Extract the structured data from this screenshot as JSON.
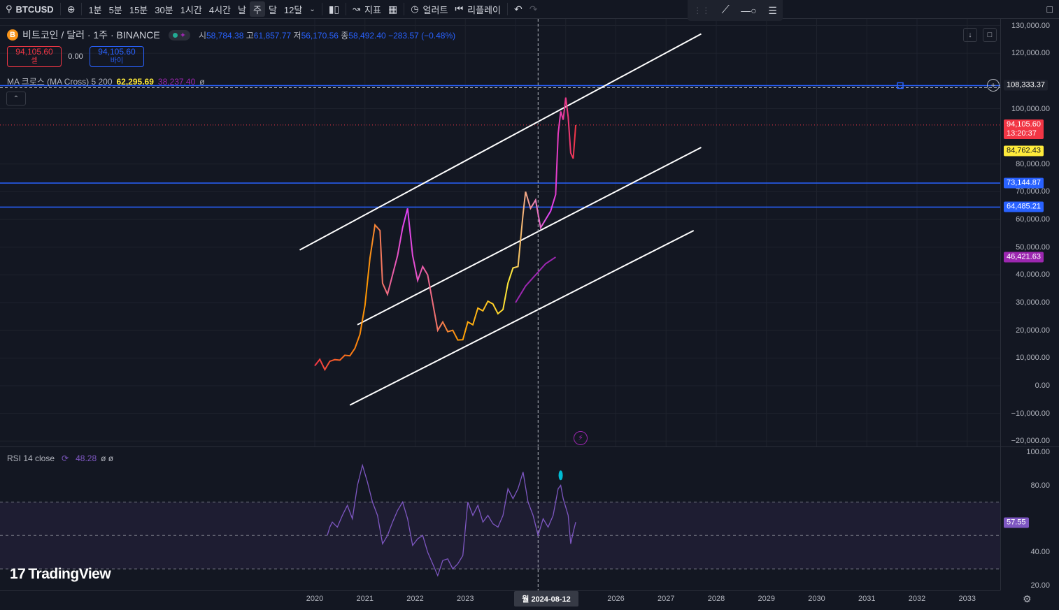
{
  "toolbar": {
    "symbol": "BTCUSD",
    "intervals": [
      "1분",
      "5분",
      "15분",
      "30분",
      "1시간",
      "4시간",
      "날",
      "주",
      "달",
      "12달"
    ],
    "active_interval": "주",
    "indicators_label": "지표",
    "alert_label": "얼러트",
    "replay_label": "리플레이"
  },
  "legend": {
    "title": "비트코인 / 달러 · 1주 · BINANCE",
    "o_label": "시",
    "o": "58,784.38",
    "h_label": "고",
    "h": "61,857.77",
    "l_label": "저",
    "l": "56,170.56",
    "c_label": "종",
    "c": "58,492.40",
    "change": "−283.57 (−0.48%)"
  },
  "sell": {
    "price": "94,105.60",
    "label": "셀"
  },
  "spread": "0.00",
  "buy": {
    "price": "94,105.60",
    "label": "바이"
  },
  "ma_indicator": {
    "name": "MA 크로스 (MA Cross) 5 200",
    "v1": "62,295.69",
    "v2": "38,237.40",
    "tail": "ø"
  },
  "rsi_indicator": {
    "name": "RSI 14 close",
    "value": "48.28",
    "tail": "ø ø"
  },
  "price_axis_labels": [
    {
      "label": "130,000.00",
      "v": 130000
    },
    {
      "label": "120,000.00",
      "v": 120000
    },
    {
      "label": "100,000.00",
      "v": 100000
    },
    {
      "label": "80,000.00",
      "v": 80000
    },
    {
      "label": "70,000.00",
      "v": 70000
    },
    {
      "label": "60,000.00",
      "v": 60000
    },
    {
      "label": "50,000.00",
      "v": 50000
    },
    {
      "label": "40,000.00",
      "v": 40000
    },
    {
      "label": "30,000.00",
      "v": 30000
    },
    {
      "label": "20,000.00",
      "v": 20000
    },
    {
      "label": "10,000.00",
      "v": 10000
    },
    {
      "label": "0.00",
      "v": 0
    },
    {
      "label": "−10,000.00",
      "v": -10000
    },
    {
      "label": "−20,000.00",
      "v": -20000
    }
  ],
  "rsi_axis_labels": [
    {
      "label": "100.00",
      "v": 100
    },
    {
      "label": "80.00",
      "v": 80
    },
    {
      "label": "40.00",
      "v": 40
    },
    {
      "label": "20.00",
      "v": 20
    }
  ],
  "price_tags": [
    {
      "label": "108,333.37",
      "v": 108333.37,
      "bg": "#1e222d",
      "color": "#ffffff"
    },
    {
      "label": "94,105.60",
      "sub": "13:20:37",
      "v": 94105.6,
      "bg": "#f23645",
      "color": "#ffffff"
    },
    {
      "label": "84,762.43",
      "v": 84762.43,
      "bg": "#ffeb3b",
      "color": "#131722"
    },
    {
      "label": "73,144.87",
      "v": 73144.87,
      "bg": "#2962ff",
      "color": "#ffffff"
    },
    {
      "label": "64,485.21",
      "v": 64485.21,
      "bg": "#2962ff",
      "color": "#ffffff"
    },
    {
      "label": "46,421.63",
      "v": 46421.63,
      "bg": "#9c27b0",
      "color": "#ffffff"
    }
  ],
  "rsi_tag": {
    "label": "57.55",
    "v": 57.55,
    "bg": "#7e57c2",
    "color": "#ffffff"
  },
  "time_axis": [
    "2020",
    "2021",
    "2022",
    "2023",
    "2026",
    "2027",
    "2028",
    "2029",
    "2030",
    "2031",
    "2032",
    "2033"
  ],
  "crosshair_date": "월 2024-08-12",
  "brand": "TradingView",
  "chart_data": {
    "type": "line",
    "x_unit": "year",
    "price_series": [
      [
        2020.0,
        7200
      ],
      [
        2020.1,
        9500
      ],
      [
        2020.2,
        5800
      ],
      [
        2020.3,
        8800
      ],
      [
        2020.4,
        9400
      ],
      [
        2020.5,
        9200
      ],
      [
        2020.6,
        11000
      ],
      [
        2020.7,
        10800
      ],
      [
        2020.8,
        13500
      ],
      [
        2020.9,
        18500
      ],
      [
        2021.0,
        29000
      ],
      [
        2021.1,
        46000
      ],
      [
        2021.2,
        58000
      ],
      [
        2021.3,
        56000
      ],
      [
        2021.35,
        37000
      ],
      [
        2021.45,
        33000
      ],
      [
        2021.55,
        40000
      ],
      [
        2021.65,
        47000
      ],
      [
        2021.75,
        57000
      ],
      [
        2021.85,
        64000
      ],
      [
        2021.95,
        47000
      ],
      [
        2022.05,
        38000
      ],
      [
        2022.15,
        43000
      ],
      [
        2022.25,
        40000
      ],
      [
        2022.35,
        30000
      ],
      [
        2022.45,
        20000
      ],
      [
        2022.55,
        23000
      ],
      [
        2022.65,
        19500
      ],
      [
        2022.75,
        20000
      ],
      [
        2022.85,
        16500
      ],
      [
        2022.95,
        16600
      ],
      [
        2023.05,
        23000
      ],
      [
        2023.15,
        22000
      ],
      [
        2023.25,
        28000
      ],
      [
        2023.35,
        27000
      ],
      [
        2023.45,
        30500
      ],
      [
        2023.55,
        29500
      ],
      [
        2023.65,
        26000
      ],
      [
        2023.75,
        27500
      ],
      [
        2023.85,
        37000
      ],
      [
        2023.95,
        42500
      ],
      [
        2024.05,
        43000
      ],
      [
        2024.15,
        62000
      ],
      [
        2024.2,
        70000
      ],
      [
        2024.3,
        64000
      ],
      [
        2024.4,
        67000
      ],
      [
        2024.5,
        57000
      ],
      [
        2024.6,
        60000
      ],
      [
        2024.7,
        63000
      ],
      [
        2024.8,
        69000
      ],
      [
        2024.85,
        91000
      ],
      [
        2024.9,
        99000
      ],
      [
        2024.95,
        96000
      ],
      [
        2025.0,
        104000
      ],
      [
        2025.05,
        97000
      ],
      [
        2025.1,
        84000
      ],
      [
        2025.15,
        82000
      ],
      [
        2025.2,
        94105
      ]
    ],
    "ma200_series": [
      [
        2024.0,
        30000
      ],
      [
        2024.2,
        36000
      ],
      [
        2024.4,
        40000
      ],
      [
        2024.6,
        44000
      ],
      [
        2024.8,
        46421
      ]
    ],
    "channel_lines": [
      [
        [
          2019.7,
          49000
        ],
        [
          2027.7,
          127000
        ]
      ],
      [
        [
          2020.85,
          22000
        ],
        [
          2027.7,
          86000
        ]
      ],
      [
        [
          2020.7,
          -7000
        ],
        [
          2027.55,
          56000
        ]
      ]
    ],
    "hlines": [
      108333.37,
      73144.87,
      64485.21
    ],
    "rsi_series": [
      [
        2020.25,
        50
      ],
      [
        2020.3,
        55
      ],
      [
        2020.35,
        58
      ],
      [
        2020.45,
        55
      ],
      [
        2020.55,
        62
      ],
      [
        2020.65,
        68
      ],
      [
        2020.75,
        60
      ],
      [
        2020.85,
        80
      ],
      [
        2020.95,
        92
      ],
      [
        2021.05,
        82
      ],
      [
        2021.15,
        70
      ],
      [
        2021.25,
        62
      ],
      [
        2021.35,
        45
      ],
      [
        2021.45,
        50
      ],
      [
        2021.55,
        58
      ],
      [
        2021.65,
        65
      ],
      [
        2021.75,
        70
      ],
      [
        2021.85,
        60
      ],
      [
        2021.95,
        44
      ],
      [
        2022.05,
        48
      ],
      [
        2022.15,
        50
      ],
      [
        2022.25,
        40
      ],
      [
        2022.35,
        33
      ],
      [
        2022.45,
        26
      ],
      [
        2022.55,
        35
      ],
      [
        2022.65,
        36
      ],
      [
        2022.75,
        30
      ],
      [
        2022.85,
        33
      ],
      [
        2022.95,
        38
      ],
      [
        2023.05,
        70
      ],
      [
        2023.15,
        62
      ],
      [
        2023.25,
        68
      ],
      [
        2023.35,
        58
      ],
      [
        2023.45,
        62
      ],
      [
        2023.55,
        57
      ],
      [
        2023.65,
        55
      ],
      [
        2023.75,
        62
      ],
      [
        2023.85,
        78
      ],
      [
        2023.95,
        72
      ],
      [
        2024.05,
        78
      ],
      [
        2024.15,
        88
      ],
      [
        2024.25,
        70
      ],
      [
        2024.35,
        62
      ],
      [
        2024.45,
        50
      ],
      [
        2024.55,
        60
      ],
      [
        2024.65,
        55
      ],
      [
        2024.75,
        62
      ],
      [
        2024.85,
        78
      ],
      [
        2024.9,
        80
      ],
      [
        2024.95,
        72
      ],
      [
        2025.05,
        62
      ],
      [
        2025.1,
        45
      ],
      [
        2025.15,
        52
      ],
      [
        2025.2,
        58
      ]
    ],
    "rsi_levels": [
      70,
      50,
      30
    ],
    "price_ylim": [
      -20000,
      130000
    ],
    "rsi_ylim": [
      20,
      100
    ]
  }
}
